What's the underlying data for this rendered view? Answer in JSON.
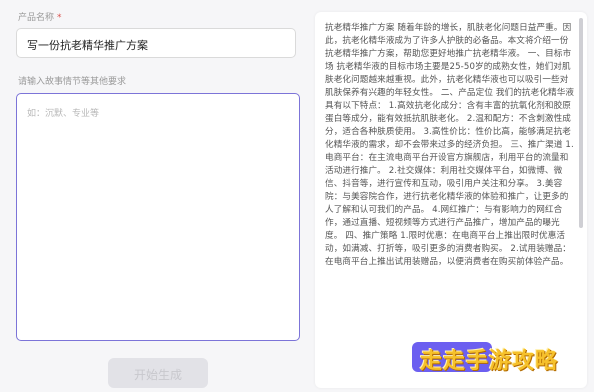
{
  "form": {
    "name_label": "产品名称",
    "required_mark": "*",
    "name_value": "写一份抗老精华推广方案",
    "story_label": "请输入故事情节等其他要求",
    "story_placeholder": "如：沉默、专业等",
    "generate_label": "开始生成"
  },
  "output": {
    "article": "抗老精华推广方案 随着年龄的增长，肌肤老化问题日益严重。因此，抗老化精华液成为了许多人护肤的必备品。本文将介绍一份抗老精华推广方案，帮助您更好地推广抗老精华液。 一、目标市场 抗老精华液的目标市场主要是25-50岁的成熟女性，她们对肌肤老化问题越来越重视。此外，抗老化精华液也可以吸引一些对肌肤保养有兴趣的年轻女性。 二、产品定位 我们的抗老化精华液具有以下特点： 1.高效抗老化成分：含有丰富的抗氧化剂和胶原蛋白等成分，能有效抵抗肌肤老化。 2.温和配方：不含刺激性成分，适合各种肤质使用。 3.高性价比：性价比高，能够满足抗老化精华液的需求，却不会带来过多的经济负担。 三、推广渠道 1.电商平台：在主流电商平台开设官方旗舰店，利用平台的流量和活动进行推广。 2.社交媒体：利用社交媒体平台，如微博、微信、抖音等，进行宣传和互动，吸引用户关注和分享。 3.美容院：与美容院合作，进行抗老化精华液的体验和推广，让更多的人了解和认可我们的产品。 4.网红推广：与有影响力的网红合作，通过直播、短视频等方式进行产品推广，增加产品的曝光度。 四、推广策略 1.限时优惠：在电商平台上推出限时优惠活动，如满减、打折等，吸引更多的消费者购买。 2.试用装赠品：在电商平台上推出试用装赠品，以便消费者在购买前体验产品。"
  },
  "watermark": "走走手游攻略"
}
